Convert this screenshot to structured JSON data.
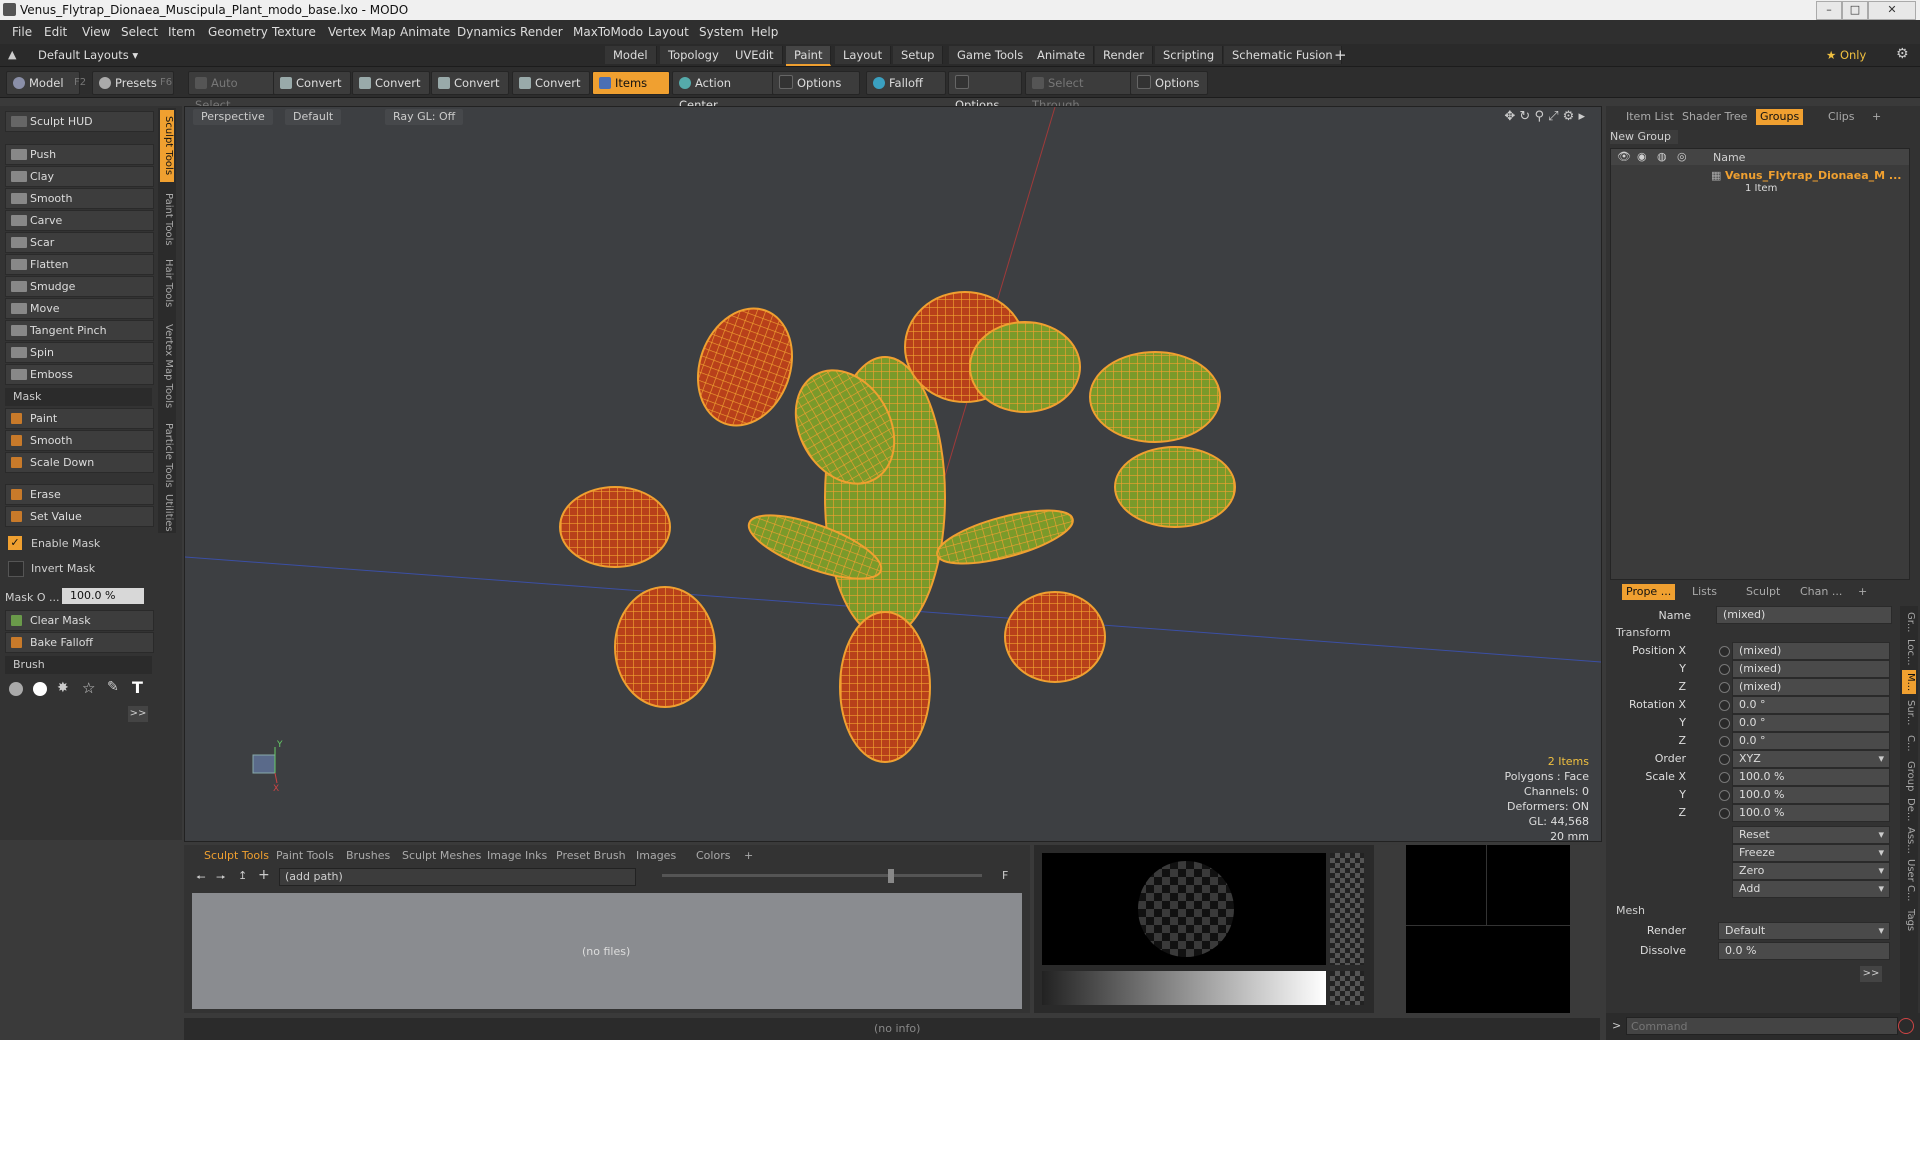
{
  "window": {
    "title": "Venus_Flytrap_Dionaea_Muscipula_Plant_modo_base.lxo - MODO",
    "controls": [
      "–",
      "□",
      "✕"
    ]
  },
  "menu": [
    "File",
    "Edit",
    "View",
    "Select",
    "Item",
    "Geometry",
    "Texture",
    "Vertex Map",
    "Animate",
    "Dynamics",
    "Render",
    "MaxToModo",
    "Layout",
    "System",
    "Help"
  ],
  "layout_bar": {
    "default_layouts": "Default Layouts ▾",
    "tabs": [
      "Model",
      "Topology",
      "UVEdit",
      "Paint",
      "Layout",
      "Setup",
      "Game Tools",
      "Animate",
      "Render",
      "Scripting",
      "Schematic Fusion"
    ],
    "active_tab": "Paint",
    "plus": "+",
    "only": "★ Only"
  },
  "toolbar": {
    "model": "Model",
    "model_key": "F2",
    "presets": "Presets",
    "presets_key": "F6",
    "auto_select": "Auto Select",
    "convert1": "Convert",
    "convert2": "Convert",
    "convert3": "Convert",
    "convert4": "Convert",
    "items": "Items",
    "action_center": "Action Center",
    "options1": "Options",
    "falloff": "Falloff",
    "options2": "Options",
    "select_through": "Select Through",
    "options3": "Options"
  },
  "left_panel": {
    "sculpt_hud": "Sculpt HUD",
    "tools": [
      "Push",
      "Clay",
      "Smooth",
      "Carve",
      "Scar",
      "Flatten",
      "Smudge",
      "Move",
      "Tangent Pinch",
      "Spin",
      "Emboss"
    ],
    "mask_section": "Mask",
    "mask_tools": [
      "Paint",
      "Smooth",
      "Scale Down"
    ],
    "erase": "Erase",
    "set_value": "Set Value",
    "enable_mask": "Enable Mask",
    "invert_mask": "Invert Mask",
    "mask_opacity_label": "Mask O ...",
    "mask_opacity_value": "100.0 %",
    "clear_mask": "Clear Mask",
    "bake_falloff": "Bake Falloff",
    "brush_section": "Brush",
    "more": ">>",
    "vertical_tabs": [
      "Sculpt Tools",
      "Paint Tools",
      "Hair Tools",
      "Vertex Map Tools",
      "Particle Tools",
      "Utilities"
    ]
  },
  "viewport": {
    "view": "Perspective",
    "shading": "Default",
    "raygl": "Ray GL: Off",
    "stats": [
      "2 Items",
      "Polygons : Face",
      "Channels: 0",
      "Deformers: ON",
      "GL: 44,568",
      "20 mm"
    ],
    "axis_y": "Y",
    "axis_x": "X"
  },
  "bottom_panel": {
    "tabs": [
      "Sculpt Tools",
      "Paint Tools",
      "Brushes",
      "Sculpt Meshes",
      "Image Inks",
      "Preset Brush",
      "Images",
      "Colors",
      "+"
    ],
    "active_tab": "Sculpt Tools",
    "path_placeholder": "(add path)",
    "f_label": "F",
    "no_files": "(no files)"
  },
  "info_bar": "(no info)",
  "right_top": {
    "tabs": [
      "Item List",
      "Shader Tree",
      "Groups",
      "Clips",
      "+"
    ],
    "active_tab": "Groups",
    "new_group": "New Group",
    "col_name": "Name",
    "group_name": "Venus_Flytrap_Dionaea_M ...",
    "group_count": "1 Item"
  },
  "properties": {
    "tabs": [
      "Prope ...",
      "Lists",
      "Sculpt",
      "Chan ...",
      "+"
    ],
    "active_tab": "Prope ...",
    "name_label": "Name",
    "name_value": "(mixed)",
    "transform": "Transform",
    "position_x_label": "Position X",
    "position_x": "(mixed)",
    "position_y_label": "Y",
    "position_y": "(mixed)",
    "position_z_label": "Z",
    "position_z": "(mixed)",
    "rotation_x_label": "Rotation X",
    "rotation_x": "0.0 °",
    "rotation_y_label": "Y",
    "rotation_y": "0.0 °",
    "rotation_z_label": "Z",
    "rotation_z": "0.0 °",
    "order_label": "Order",
    "order": "XYZ",
    "scale_x_label": "Scale X",
    "scale_x": "100.0 %",
    "scale_y_label": "Y",
    "scale_y": "100.0 %",
    "scale_z_label": "Z",
    "scale_z": "100.0 %",
    "reset": "Reset",
    "freeze": "Freeze",
    "zero": "Zero",
    "add": "Add",
    "mesh": "Mesh",
    "render_label": "Render",
    "render": "Default",
    "dissolve_label": "Dissolve",
    "dissolve": "0.0 %",
    "more": ">>",
    "side_tabs": [
      "Gr...",
      "Loc...",
      "M...",
      "Sur...",
      "C...",
      "Group",
      "De...",
      "Ass...",
      "User C...",
      "Tags"
    ]
  },
  "command": {
    "prompt": ">",
    "placeholder": "Command"
  },
  "colors": {
    "accent": "#f0a030",
    "panel": "#333333",
    "viewport": "#3d3f42"
  }
}
